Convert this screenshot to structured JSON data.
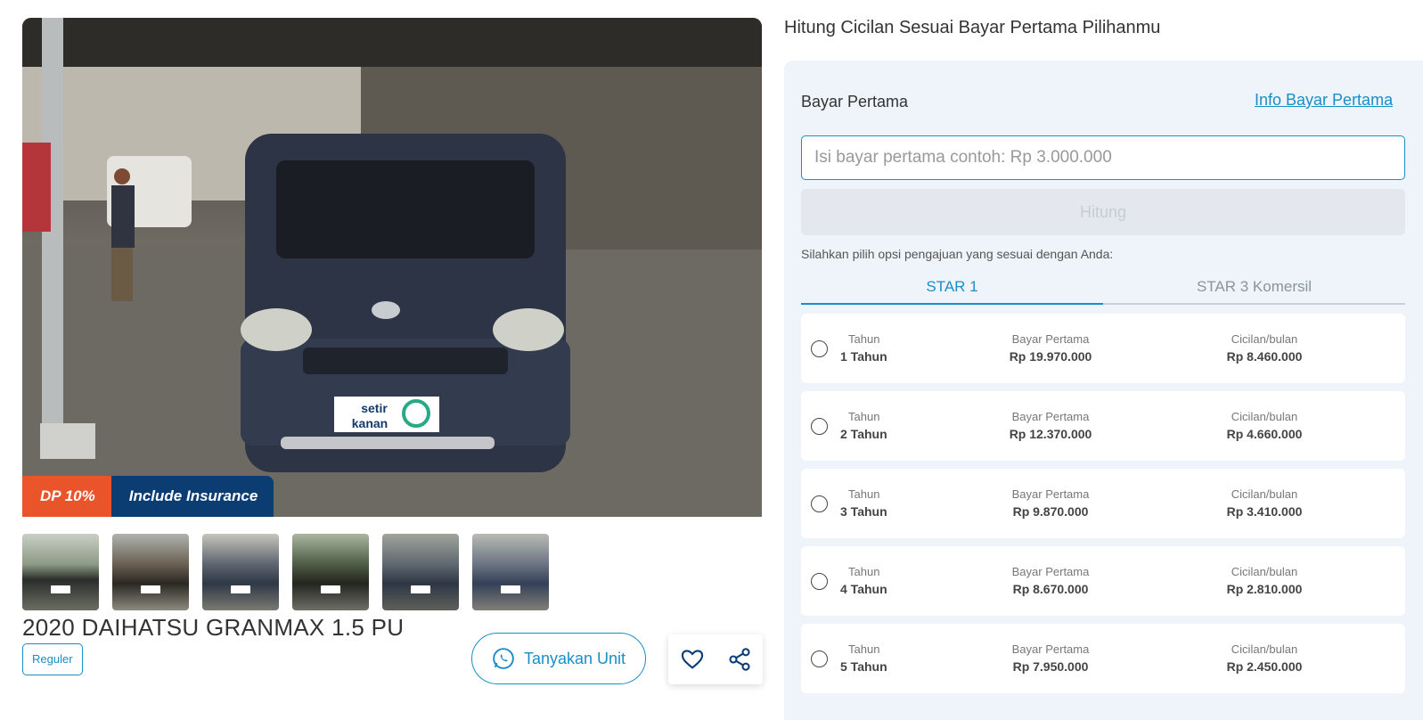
{
  "product": {
    "title": "2020 DAIHATSU GRANMAX 1.5 PU",
    "badge_dp": "DP 10%",
    "badge_insurance": "Include Insurance",
    "plate_logo": "setir kanan",
    "category_tag": "Reguler",
    "ask_button": "Tanyakan Unit",
    "thumbnail_count": 6
  },
  "calculator": {
    "heading": "Hitung Cicilan Sesuai Bayar Pertama Pilihanmu",
    "bayar_label": "Bayar Pertama",
    "info_link": "Info Bayar Pertama",
    "input_placeholder": "Isi bayar pertama contoh: Rp 3.000.000",
    "hitung_button": "Hitung",
    "hint": "Silahkan pilih opsi pengajuan yang sesuai dengan Anda:",
    "tabs": [
      {
        "label": "STAR 1",
        "active": true
      },
      {
        "label": "STAR 3 Komersil",
        "active": false
      }
    ],
    "options": [
      {
        "tenor_label": "Tahun",
        "tenor": "1 Tahun",
        "dp_label": "Bayar Pertama",
        "dp": "Rp 19.970.000",
        "inst_label": "Cicilan/bulan",
        "inst": "Rp 8.460.000"
      },
      {
        "tenor_label": "Tahun",
        "tenor": "2 Tahun",
        "dp_label": "Bayar Pertama",
        "dp": "Rp 12.370.000",
        "inst_label": "Cicilan/bulan",
        "inst": "Rp 4.660.000"
      },
      {
        "tenor_label": "Tahun",
        "tenor": "3 Tahun",
        "dp_label": "Bayar Pertama",
        "dp": "Rp 9.870.000",
        "inst_label": "Cicilan/bulan",
        "inst": "Rp 3.410.000"
      },
      {
        "tenor_label": "Tahun",
        "tenor": "4 Tahun",
        "dp_label": "Bayar Pertama",
        "dp": "Rp 8.670.000",
        "inst_label": "Cicilan/bulan",
        "inst": "Rp 2.810.000"
      },
      {
        "tenor_label": "Tahun",
        "tenor": "5 Tahun",
        "dp_label": "Bayar Pertama",
        "dp": "Rp 7.950.000",
        "inst_label": "Cicilan/bulan",
        "inst": "Rp 2.450.000"
      }
    ]
  },
  "colors": {
    "accent": "#1a8ec8",
    "dp_badge": "#e9542a",
    "insurance_badge": "#0b3d73",
    "panel_bg": "#eef4f9"
  },
  "icons": [
    "whatsapp-icon",
    "heart-icon",
    "share-icon"
  ]
}
